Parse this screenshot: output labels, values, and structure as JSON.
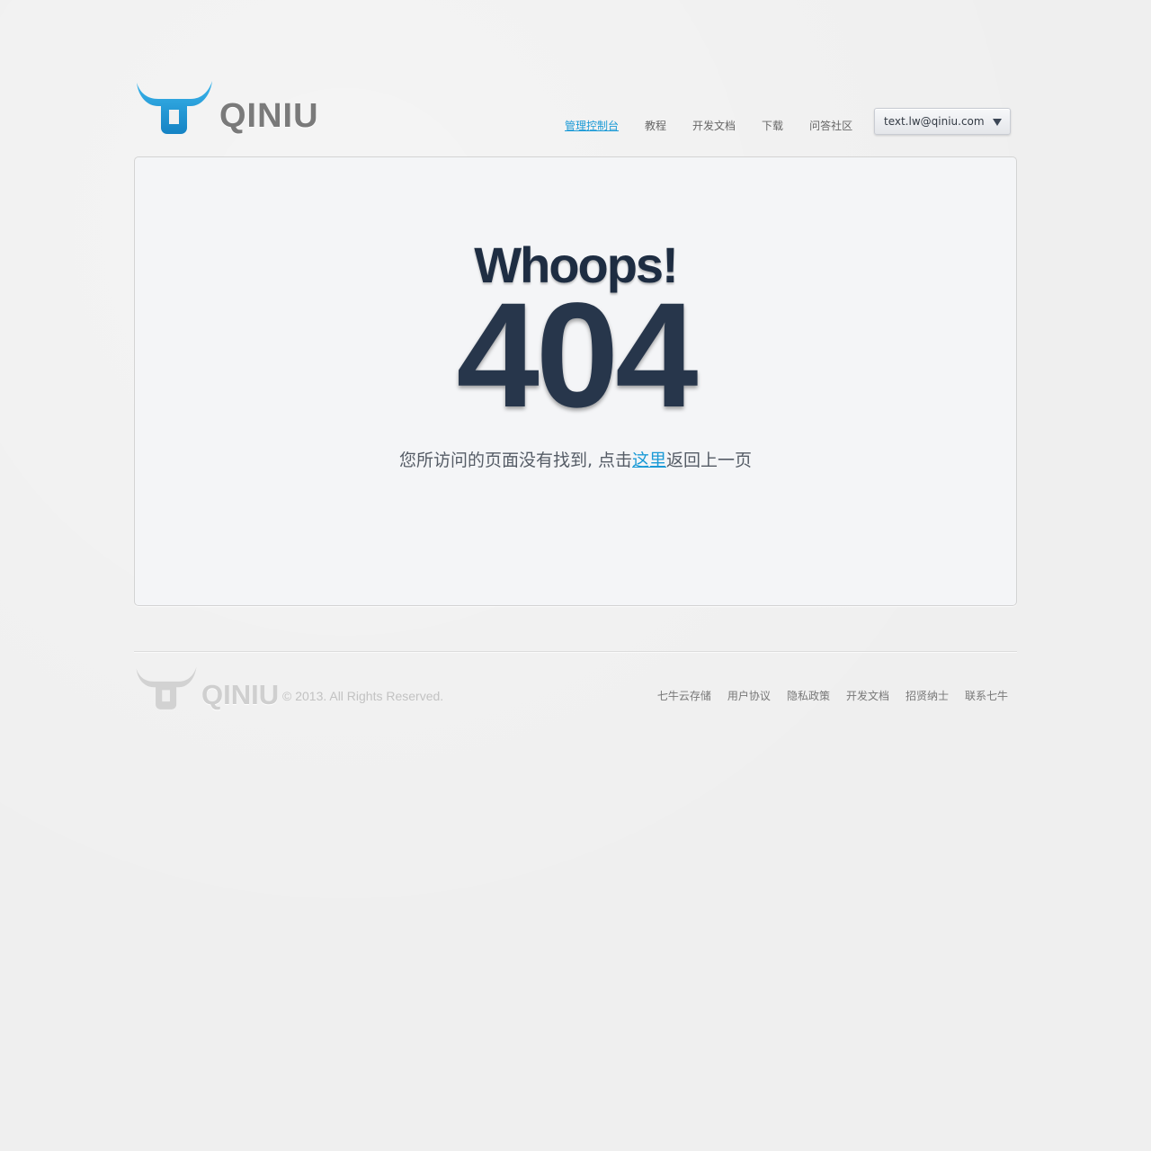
{
  "header": {
    "logo_text": "QINIU",
    "nav": [
      {
        "label": "管理控制台",
        "active": true
      },
      {
        "label": "教程",
        "active": false
      },
      {
        "label": "开发文档",
        "active": false
      },
      {
        "label": "下载",
        "active": false
      },
      {
        "label": "问答社区",
        "active": false
      }
    ],
    "account_email": "text.lw@qiniu.com"
  },
  "main": {
    "headline": "Whoops!",
    "error_code": "404",
    "message_before": "您所访问的页面没有找到, 点击",
    "message_link": "这里",
    "message_after": "返回上一页"
  },
  "footer": {
    "logo_text": "QINIU",
    "copyright": "© 2013. All Rights Reserved.",
    "links": [
      "七牛云存储",
      "用户协议",
      "隐私政策",
      "开发文档",
      "招贤纳士",
      "联系七牛"
    ]
  },
  "colors": {
    "accent": "#1b9ad6",
    "headline": "#1e2d42",
    "background": "#efefef",
    "panel": "#f4f5f7"
  },
  "icons": {
    "brand": "bull-head-icon",
    "dropdown": "caret-down-icon"
  }
}
